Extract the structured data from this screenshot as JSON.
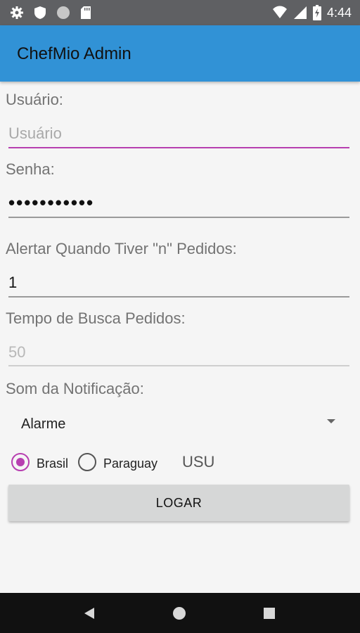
{
  "status_bar": {
    "time": "4:44",
    "left_icons": [
      "gear-icon",
      "shield-icon",
      "circle-icon",
      "sd-card-icon"
    ],
    "right_icons": [
      "wifi-icon",
      "signal-icon",
      "battery-icon"
    ]
  },
  "app_bar": {
    "title": "ChefMio Admin",
    "color": "#3192d6"
  },
  "form": {
    "usuario_label": "Usuário:",
    "usuario_placeholder": "Usuário",
    "senha_label": "Senha:",
    "senha_value": "•••••••••••",
    "alertar_label": "Alertar Quando Tiver \"n\" Pedidos:",
    "alertar_value": "1",
    "tempo_label": "Tempo de Busca Pedidos:",
    "tempo_value": "50",
    "som_label": "Som da Notificação:",
    "som_selected": "Alarme"
  },
  "country": {
    "options": [
      "Brasil",
      "Paraguay"
    ],
    "selected": "Brasil",
    "extra_text": "USU"
  },
  "button": {
    "label": "LOGAR"
  },
  "colors": {
    "accent": "#b73fb0",
    "primary": "#3192d6"
  }
}
